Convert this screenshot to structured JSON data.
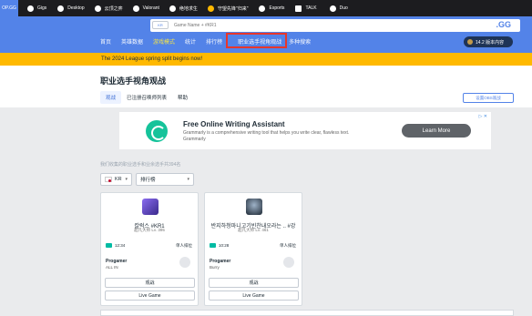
{
  "topbar": {
    "first": "OP.GG",
    "items": [
      {
        "icon": "gigs-icon",
        "label": "Gigs"
      },
      {
        "icon": "desktop-icon",
        "label": "Desktop"
      },
      {
        "icon": "yunding-icon",
        "label": "云顶之弈"
      },
      {
        "icon": "valorant-icon",
        "label": "Valorant"
      },
      {
        "icon": "pubg-icon",
        "label": "绝地求生"
      },
      {
        "icon": "warning-icon",
        "label": "守望先锋\"归来\""
      },
      {
        "icon": "esports-icon",
        "label": "Esports"
      },
      {
        "icon": "talk-icon",
        "label": "TALK"
      },
      {
        "icon": "duo-icon",
        "label": "Duo"
      }
    ]
  },
  "search": {
    "region": "KR",
    "placeholder": "Game Name + #KR1",
    "brand": ".GG"
  },
  "nav": {
    "items": [
      "首页",
      "英雄数据",
      "游戏模式",
      "统计",
      "排行榜",
      "职业选手视角观战",
      "多种搜索"
    ],
    "active_index": 2,
    "rank": "14.2 版本内容"
  },
  "banner": "The 2024 League spring split begins now!",
  "page": {
    "title": "职业选手视角观战",
    "tabs": [
      "观战",
      "已注册召唤师列表",
      "帮助"
    ],
    "settings_button": "设置OBS观战"
  },
  "ad": {
    "title": "Free Online Writing Assistant",
    "desc": "Grammarly is a comprehensive writing tool that helps you write clear, flawless text.",
    "brand": "Grammarly",
    "button": "Learn More",
    "mark": "▷ ✕"
  },
  "subtitle": "我们收集的职业选手和业余选手共394名",
  "filters": {
    "region": "KR",
    "sort": "排行榜"
  },
  "cards": [
    {
      "name": "칼럭스 #KR1",
      "level": "超凡大师 Lv. 395",
      "time": "12:34",
      "queue": "单人排位",
      "pro_label": "Progamer",
      "team": "ALL IN",
      "spectate": "观战",
      "live": "Live Game",
      "avatar_color": "#6b4fd8"
    },
    {
      "name": "반지하청마니고기빈찬내오라는 .. #강",
      "level": "超凡大师 Lv. 461",
      "time": "10:28",
      "queue": "单人排位",
      "pro_label": "Progamer",
      "team": "Burry",
      "spectate": "观战",
      "live": "Live Game",
      "avatar_color": "#2a3a4a"
    }
  ],
  "colors": {
    "primary": "#5383e8",
    "banner": "#ffb900",
    "highlight": "#e8362b",
    "active_nav": "#fde93f"
  }
}
